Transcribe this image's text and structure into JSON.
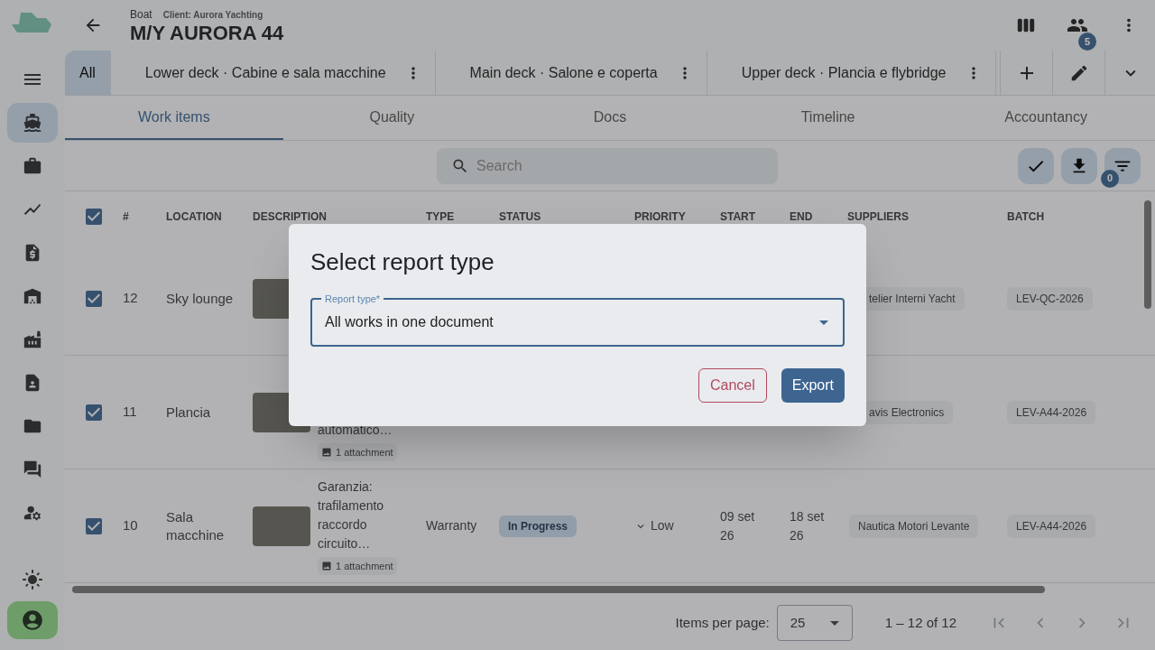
{
  "header": {
    "breadcrumb": "Boat",
    "client": "Client: Aurora Yachting",
    "title": "M/Y AURORA 44",
    "team_badge": "5"
  },
  "sidebar": {
    "items": [
      {
        "selected": true
      },
      {
        "selected": false
      },
      {
        "selected": false
      },
      {
        "selected": false
      },
      {
        "selected": false
      },
      {
        "selected": false
      },
      {
        "selected": false
      },
      {
        "selected": false
      },
      {
        "selected": false
      },
      {
        "selected": false
      }
    ]
  },
  "deck_tabs": [
    {
      "label": "All",
      "selected": true
    },
    {
      "label": "Lower deck · Cabine e sala macchine",
      "selected": false
    },
    {
      "label": "Main deck · Salone e coperta",
      "selected": false
    },
    {
      "label": "Upper deck · Plancia e flybridge",
      "selected": false
    }
  ],
  "tabs": [
    {
      "label": "Work items",
      "selected": true
    },
    {
      "label": "Quality",
      "selected": false
    },
    {
      "label": "Docs",
      "selected": false
    },
    {
      "label": "Timeline",
      "selected": false
    },
    {
      "label": "Accountancy",
      "selected": false
    }
  ],
  "search": {
    "placeholder": "Search"
  },
  "filter_badge": "0",
  "table": {
    "all_checked": true,
    "columns": [
      "#",
      "LOCATION",
      "DESCRIPTION",
      "TYPE",
      "STATUS",
      "PRIORITY",
      "START",
      "END",
      "SUPPLIERS",
      "BATCH"
    ],
    "rows": [
      {
        "checked": true,
        "number": "12",
        "location": "Sky lounge",
        "photo": true,
        "supplier": "telier Interni Yacht",
        "supplier_partial": true,
        "batch": "LEV-QC-2026"
      },
      {
        "checked": true,
        "number": "11",
        "location": "Plancia",
        "photo": true,
        "description": "automatico…",
        "attachment": "1 attachment",
        "supplier": "avis Electronics",
        "supplier_partial": true,
        "batch": "LEV-A44-2026"
      },
      {
        "checked": true,
        "number": "10",
        "location": "Sala macchine",
        "photo": true,
        "description": "Garanzia: trafilamento raccordo circuito…",
        "attachment": "1 attachment",
        "type": "Warranty",
        "status": "In Progress",
        "priority": "Low",
        "start": "09 set 26",
        "end": "18 set 26",
        "supplier": "Nautica Motori Levante",
        "supplier_partial": false,
        "batch": "LEV-A44-2026"
      }
    ]
  },
  "pagination": {
    "label": "Items per page:",
    "per_page": "25",
    "range": "1 – 12 of 12"
  },
  "dialog": {
    "title": "Select report type",
    "field_label": "Report type*",
    "value": "All works in one document",
    "buttons": [
      {
        "label": "Cancel",
        "kind": "outline"
      },
      {
        "label": "Export",
        "kind": "primary"
      }
    ]
  }
}
